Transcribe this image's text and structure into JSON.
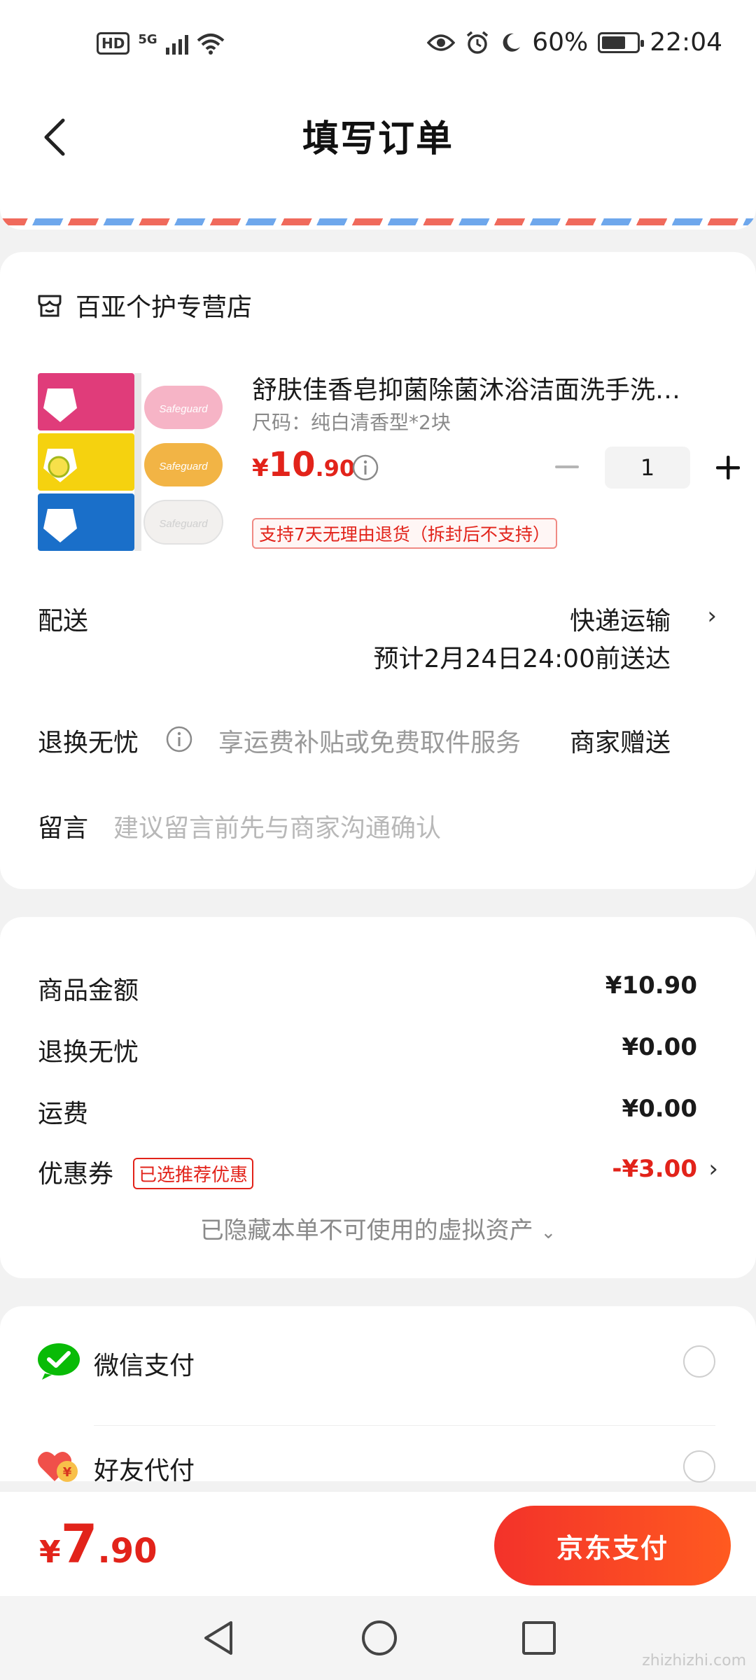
{
  "status_bar": {
    "hd": "HD",
    "network": "5G",
    "battery_percent": "60%",
    "time": "22:04"
  },
  "header": {
    "title": "填写订单",
    "back_icon": "back-arrow-icon"
  },
  "store": {
    "name": "百亚个护专营店",
    "icon": "store-icon"
  },
  "product": {
    "title": "舒肤佳香皂抑菌除菌沐浴洁面洗手洗…",
    "spec": "尺码：纯白清香型*2块",
    "price_currency": "¥",
    "price_integer": "10",
    "price_decimal": ".90",
    "quantity": "1",
    "return_policy": "支持7天无理由退货（拆封后不支持）",
    "image_brand_text": "Safeguard"
  },
  "delivery": {
    "label": "配送",
    "method": "快递运输",
    "eta": "预计2月24日24:00前送达"
  },
  "worry_free": {
    "label": "退换无忧",
    "desc": "享运费补贴或免费取件服务",
    "value": "商家赠送"
  },
  "message": {
    "label": "留言",
    "placeholder": "建议留言前先与商家沟通确认"
  },
  "summary": {
    "goods_label": "商品金额",
    "goods_value": "¥10.90",
    "worry_label": "退换无忧",
    "worry_value": "¥0.00",
    "shipping_label": "运费",
    "shipping_value": "¥0.00",
    "coupon_label": "优惠券",
    "coupon_tag": "已选推荐优惠",
    "coupon_value": "-¥3.00",
    "hidden_assets": "已隐藏本单不可使用的虚拟资产"
  },
  "payment_methods": [
    {
      "label": "微信支付",
      "icon": "wechat-pay-icon",
      "selected": false
    },
    {
      "label": "好友代付",
      "icon": "friend-pay-icon",
      "selected": false
    }
  ],
  "bottom": {
    "total_currency": "¥",
    "total_integer": "7",
    "total_decimal": ".90",
    "pay_button": "京东支付"
  },
  "watermark": "zhizhizhi.com",
  "colors": {
    "accent_red": "#e2231a",
    "pay_button_start": "#f3322a",
    "pay_button_end": "#ff5a20",
    "wechat_green": "#09bb07",
    "airmail_red": "#f06a5c",
    "airmail_blue": "#6ea7ec"
  }
}
